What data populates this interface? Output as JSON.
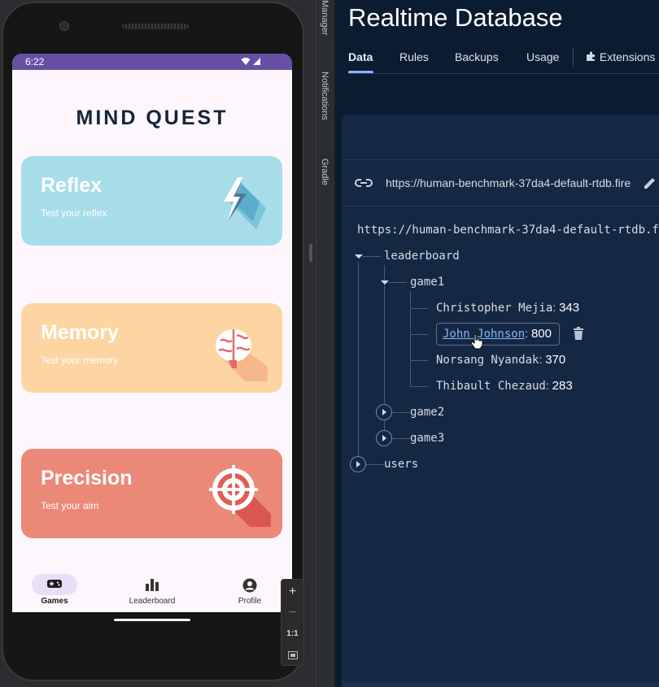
{
  "emulator": {
    "status_time": "6:22",
    "app_title": "MIND QUEST",
    "cards": [
      {
        "title": "Reflex",
        "subtitle": "Test your reflex",
        "icon": "lightning-icon"
      },
      {
        "title": "Memory",
        "subtitle": "Test your memory",
        "icon": "brain-icon"
      },
      {
        "title": "Precision",
        "subtitle": "Test your aim",
        "icon": "target-icon"
      }
    ],
    "nav": [
      {
        "label": "Games",
        "icon": "gamepad-icon",
        "selected": true
      },
      {
        "label": "Leaderboard",
        "icon": "bar-chart-icon",
        "selected": false
      },
      {
        "label": "Profile",
        "icon": "account-icon",
        "selected": false
      }
    ],
    "zoom": {
      "in": "+",
      "out": "−",
      "one_to_one": "1:1"
    }
  },
  "ide_side": {
    "tabs": [
      "Manager",
      "Notifications",
      "Gradle"
    ]
  },
  "firebase": {
    "title": "Realtime Database",
    "tabs": [
      "Data",
      "Rules",
      "Backups",
      "Usage",
      "Extensions"
    ],
    "active_tab": "Data",
    "url": "https://human-benchmark-37da4-default-rtdb.fire",
    "root_url": "https://human-benchmark-37da4-default-rtdb.f",
    "tree": {
      "leaderboard": "leaderboard",
      "game1": "game1",
      "entries": [
        {
          "name": "Christopher Mejia",
          "score": "343"
        },
        {
          "name": "John  Johnson",
          "score": "800"
        },
        {
          "name": "Norsang Nyandak",
          "score": "370"
        },
        {
          "name": "Thibault Chezaud",
          "score": "283"
        }
      ],
      "game2": "game2",
      "game3": "game3",
      "users": "users"
    },
    "colors": {
      "background": "#0b1b30",
      "panel": "#142743",
      "link": "#8ab4f8"
    }
  }
}
